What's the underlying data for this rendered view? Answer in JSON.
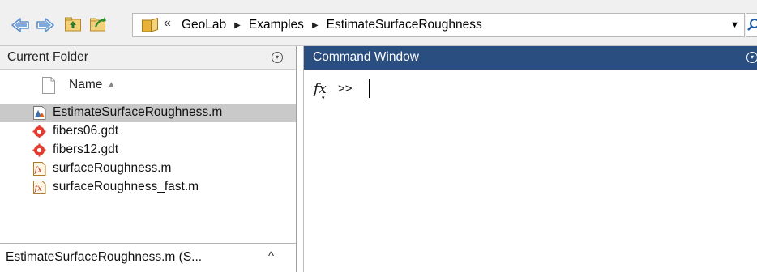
{
  "address_bar": {
    "back_icon": "back-arrow-icon",
    "forward_icon": "forward-arrow-icon",
    "up_icon": "up-folder-icon",
    "browse_icon": "browse-folder-icon",
    "overflow_chevron": "«",
    "breadcrumbs": [
      "GeoLab",
      "Examples",
      "EstimateSurfaceRoughness"
    ],
    "separator": "▶",
    "dropdown_arrow": "▼",
    "colors": {
      "arrow": "#5d8fcd",
      "folder": "#e8b23a"
    }
  },
  "current_folder": {
    "title": "Current Folder",
    "header_menu_glyph": "▾",
    "column_name": "Name",
    "sort_indicator": "▲",
    "files": [
      {
        "name": "EstimateSurfaceRoughness.m",
        "icon": "live-script-icon",
        "selected": true
      },
      {
        "name": "fibers06.gdt",
        "icon": "gdt-data-icon",
        "selected": false
      },
      {
        "name": "fibers12.gdt",
        "icon": "gdt-data-icon",
        "selected": false
      },
      {
        "name": "surfaceRoughness.m",
        "icon": "function-file-icon",
        "selected": false
      },
      {
        "name": "surfaceRoughness_fast.m",
        "icon": "function-file-icon",
        "selected": false
      }
    ],
    "details": {
      "text": "EstimateSurfaceRoughness.m  (S...",
      "caret": "^"
    }
  },
  "command_window": {
    "title": "Command Window",
    "header_menu_glyph": "▾",
    "fx_label": "fx",
    "fx_dropdown": "▾",
    "prompt": ">>",
    "header_color": "#2a4e80"
  }
}
